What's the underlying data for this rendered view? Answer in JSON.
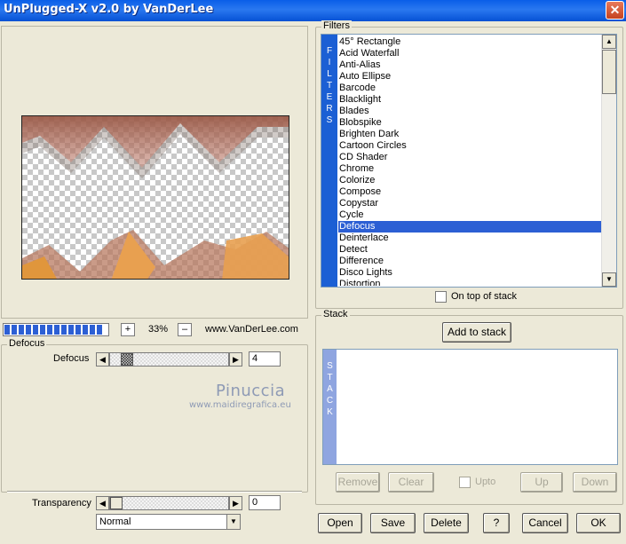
{
  "window": {
    "title": "UnPlugged-X v2.0 by VanDerLee",
    "close": "✕"
  },
  "preview": {
    "zoom_minus": "–",
    "zoom_plus": "+",
    "zoom": "33%",
    "site": "www.VanDerLee.com",
    "progress_percent": 100
  },
  "params": {
    "group_title": "Defocus",
    "defocus_label": "Defocus",
    "defocus_value": "4",
    "transparency_label": "Transparency",
    "transparency_value": "0",
    "blend_mode": "Normal",
    "arrow_left": "◀",
    "arrow_right": "▶",
    "combo_arrow": "▼"
  },
  "watermark": {
    "line1": "Pinuccia",
    "line2": "www.maidiregrafica.eu"
  },
  "filters": {
    "group_title": "Filters",
    "vertical_label": [
      "F",
      "I",
      "L",
      "T",
      "E",
      "R",
      "S"
    ],
    "items": [
      "45° Rectangle",
      "Acid Waterfall",
      "Anti-Alias",
      "Auto Ellipse",
      "Barcode",
      "Blacklight",
      "Blades",
      "Blobspike",
      "Brighten Dark",
      "Cartoon Circles",
      "CD Shader",
      "Chrome",
      "Colorize",
      "Compose",
      "Copystar",
      "Cycle",
      "Defocus",
      "Deinterlace",
      "Detect",
      "Difference",
      "Disco Lights",
      "Distortion"
    ],
    "selected": "Defocus",
    "on_top_label": "On top of stack",
    "scroll_up": "▲",
    "scroll_down": "▼"
  },
  "stack": {
    "group_title": "Stack",
    "add_button": "Add to stack",
    "vertical_label": [
      "S",
      "T",
      "A",
      "C",
      "K"
    ],
    "remove": "Remove",
    "clear": "Clear",
    "upto": "Upto",
    "up": "Up",
    "down": "Down"
  },
  "footer": {
    "open": "Open",
    "save": "Save",
    "delete": "Delete",
    "help": "?",
    "cancel": "Cancel",
    "ok": "OK"
  },
  "colors": {
    "titlebar": "#0a5ee8",
    "selection": "#2c5fd4",
    "face": "#ece9d8"
  }
}
